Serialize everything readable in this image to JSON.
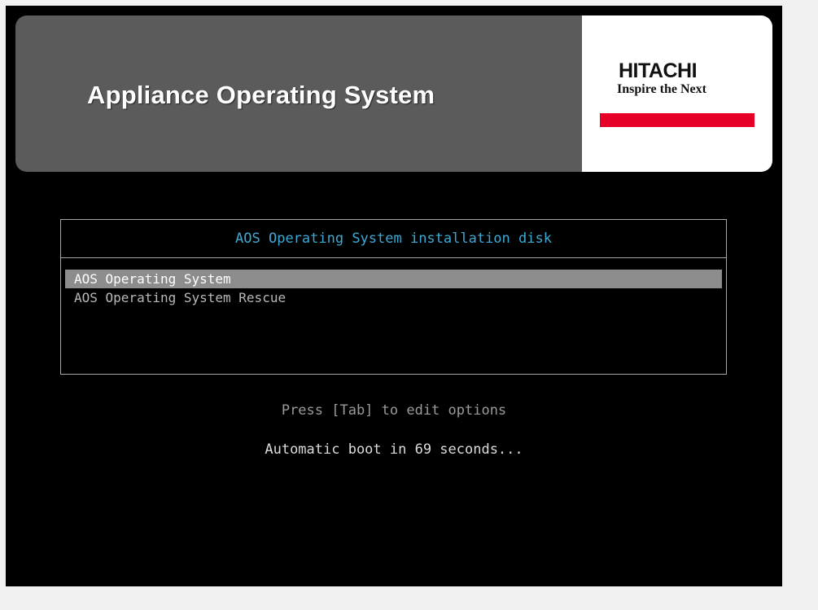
{
  "banner": {
    "title": "Appliance Operating System",
    "logo": {
      "wordmark": "HITACHI",
      "tagline": "Inspire the Next",
      "bar_color": "#e60027"
    }
  },
  "boot_menu": {
    "title": "AOS Operating System installation disk",
    "items": [
      {
        "label": "AOS Operating System",
        "selected": true
      },
      {
        "label": "AOS Operating System Rescue",
        "selected": false
      }
    ]
  },
  "footer": {
    "hint": "Press [Tab] to edit options",
    "countdown": "Automatic boot in 69 seconds..."
  },
  "colors": {
    "background": "#000000",
    "banner": "#5b5b5b",
    "menu_title": "#3da9d4",
    "selection": "#8c8c8c"
  }
}
